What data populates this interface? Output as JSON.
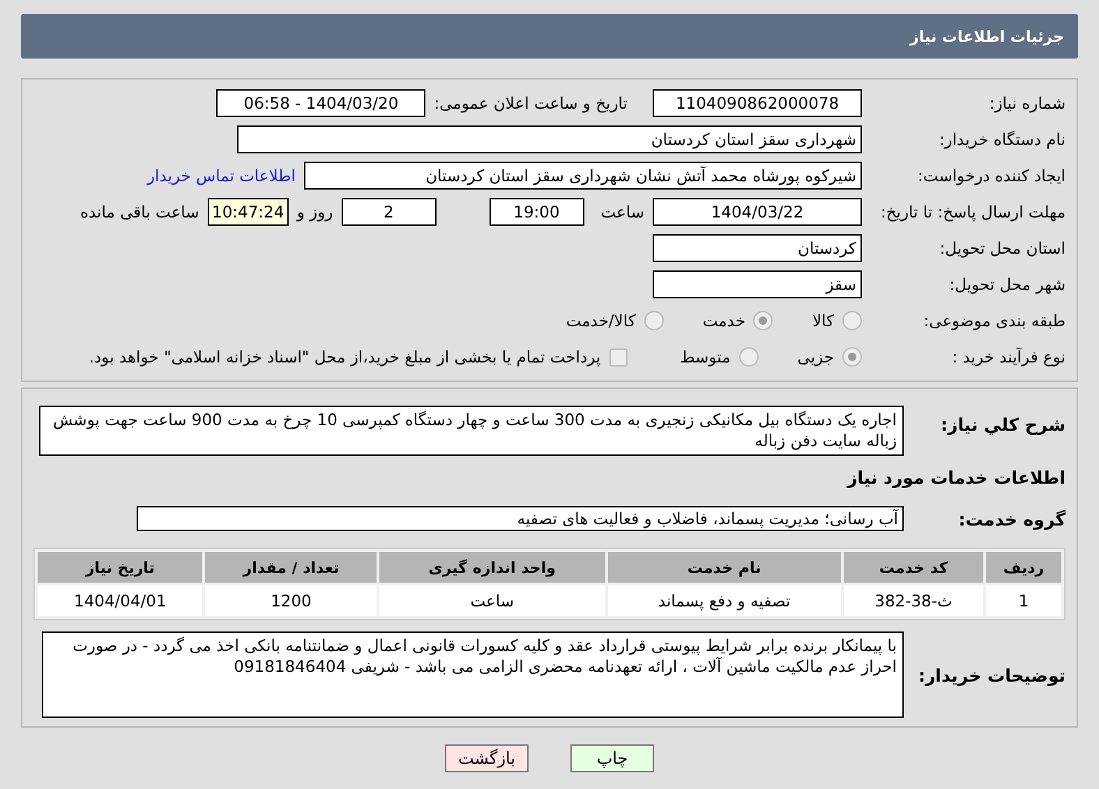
{
  "header": {
    "title": "جزئیات اطلاعات نیاز"
  },
  "need_number": {
    "label": "شماره نیاز:",
    "value": "1104090862000078"
  },
  "announce": {
    "label": "تاریخ و ساعت اعلان عمومی:",
    "value": "1404/03/20 - 06:58"
  },
  "buyer_org": {
    "label": "نام دستگاه خریدار:",
    "value": "شهرداری سقز استان کردستان"
  },
  "requester": {
    "label": "ایجاد کننده درخواست:",
    "value": "شیرکوه پورشاه محمد آتش نشان شهرداری سقز استان کردستان",
    "link": "اطلاعات تماس خریدار"
  },
  "deadline": {
    "label": "مهلت ارسال پاسخ: تا تاریخ:",
    "date": "1404/03/22",
    "time_label": "ساعت",
    "time": "19:00",
    "days": "2",
    "days_label": "روز و",
    "remaining": "10:47:24",
    "remaining_label": "ساعت باقی مانده"
  },
  "province": {
    "label": "استان محل تحویل:",
    "value": "کردستان"
  },
  "city": {
    "label": "شهر محل تحویل:",
    "value": "سقز"
  },
  "category": {
    "label": "طبقه بندی موضوعی:",
    "options": [
      {
        "label": "کالا",
        "selected": false
      },
      {
        "label": "خدمت",
        "selected": true
      },
      {
        "label": "کالا/خدمت",
        "selected": false
      }
    ]
  },
  "process": {
    "label": "نوع فرآیند خرید :",
    "options": [
      {
        "label": "جزیی",
        "selected": true
      },
      {
        "label": "متوسط",
        "selected": false
      }
    ],
    "checkbox": {
      "label": "پرداخت تمام یا بخشی از مبلغ خرید،از محل \"اسناد خزانه اسلامی\" خواهد بود.",
      "checked": false
    }
  },
  "description": {
    "label": "شرح كلي نياز:",
    "value": "اجاره یک دستگاه بیل مکانیکی زنجیری به مدت 300 ساعت و چهار دستگاه کمپرسی 10 چرخ به مدت 900 ساعت جهت پوشش زباله سایت دفن زباله"
  },
  "services_heading": "اطلاعات خدمات مورد نیاز",
  "service_group": {
    "label": "گروه خدمت:",
    "value": "آب رسانی؛ مدیریت پسماند، فاضلاب و فعالیت های تصفیه"
  },
  "table": {
    "columns": [
      "ردیف",
      "کد خدمت",
      "نام خدمت",
      "واحد اندازه گیری",
      "تعداد / مقدار",
      "تاریخ نیاز"
    ],
    "rows": [
      [
        "1",
        "ث-38-382",
        "تصفیه و دفع پسماند",
        "ساعت",
        "1200",
        "1404/04/01"
      ]
    ]
  },
  "notes": {
    "label": "توضیحات خریدار:",
    "value": "با پیمانکار برنده برابر شرایط پیوستی قرارداد عقد و کلیه کسورات قانونی اعمال و ضمانتنامه بانکی اخذ می گردد - در صورت احراز عدم مالکیت ماشین آلات ، ارائه تعهدنامه محضری الزامی می باشد - شریفی 09181846404"
  },
  "buttons": [
    {
      "label": "چاپ",
      "kind": "print"
    },
    {
      "label": "بازگشت",
      "kind": "back"
    }
  ]
}
